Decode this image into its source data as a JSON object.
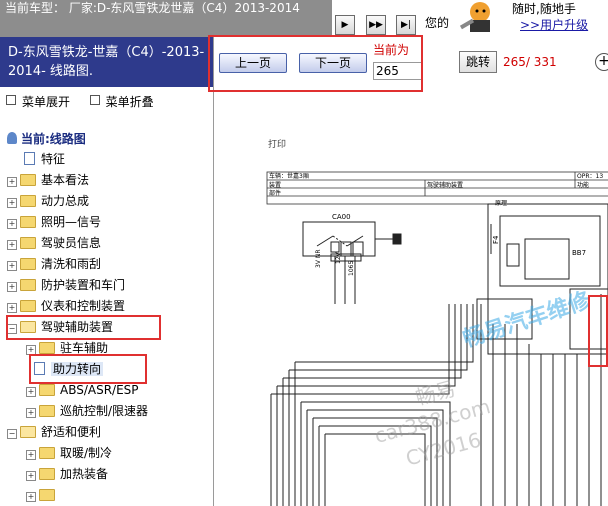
{
  "top": {
    "car_info": "当前车型：  厂家:D-东风雪铁龙世嘉（C4）2013-2014",
    "nav_buttons": [
      "▶",
      "▶▶",
      "▶|"
    ],
    "your_text": "您的",
    "ad_line1": "随时,随地手",
    "ad_link": ">>用户升级"
  },
  "left": {
    "title": "D-东风雪铁龙-世嘉（C4）-2013-2014- 线路图.",
    "expand": "菜单展开",
    "collapse": "菜单折叠",
    "tree": [
      {
        "label": "当前:线路图",
        "type": "root"
      },
      {
        "label": "特征",
        "type": "doc"
      },
      {
        "label": "基本看法",
        "type": "folder"
      },
      {
        "label": "动力总成",
        "type": "folder"
      },
      {
        "label": "照明—信号",
        "type": "folder"
      },
      {
        "label": "驾驶员信息",
        "type": "folder"
      },
      {
        "label": "清洗和雨刮",
        "type": "folder"
      },
      {
        "label": "防护装置和车门",
        "type": "folder"
      },
      {
        "label": "仪表和控制装置",
        "type": "folder"
      },
      {
        "label": "驾驶辅助装置",
        "type": "folder-open"
      },
      {
        "label": "驻车辅助",
        "type": "subfolder"
      },
      {
        "label": "助力转向",
        "type": "subdoc"
      },
      {
        "label": "ABS/ASR/ESP",
        "type": "subfolder"
      },
      {
        "label": "巡航控制/限速器",
        "type": "subfolder"
      },
      {
        "label": "舒适和便利",
        "type": "folder-open"
      },
      {
        "label": "取暖/制冷",
        "type": "subfolder"
      },
      {
        "label": "加热装备",
        "type": "subfolder"
      },
      {
        "label": "",
        "type": "subfolder"
      }
    ]
  },
  "toolbar": {
    "prev": "上一页",
    "next": "下一页",
    "current_label": "当前为",
    "current_page": "265",
    "jump": "跳转",
    "page_count": "265/ 331",
    "plus": "+"
  },
  "doc": {
    "print": "打印",
    "row1_left": "车辆：世嘉3厢",
    "row1_right": "OPR：13",
    "row2_left": "装置",
    "row2_mid": "驾驶辅助装置",
    "row2_right": "功能",
    "row3_left": "部件",
    "row3_mid": "原理",
    "connector": "CA00",
    "wire_labels": [
      "3V NR",
      "12V",
      "1065"
    ],
    "fuse_label": "F4",
    "relay_label": "BB7",
    "watermarks": [
      "畅易汽车维修",
      "畅易",
      "car388.com",
      "CY2016"
    ]
  }
}
